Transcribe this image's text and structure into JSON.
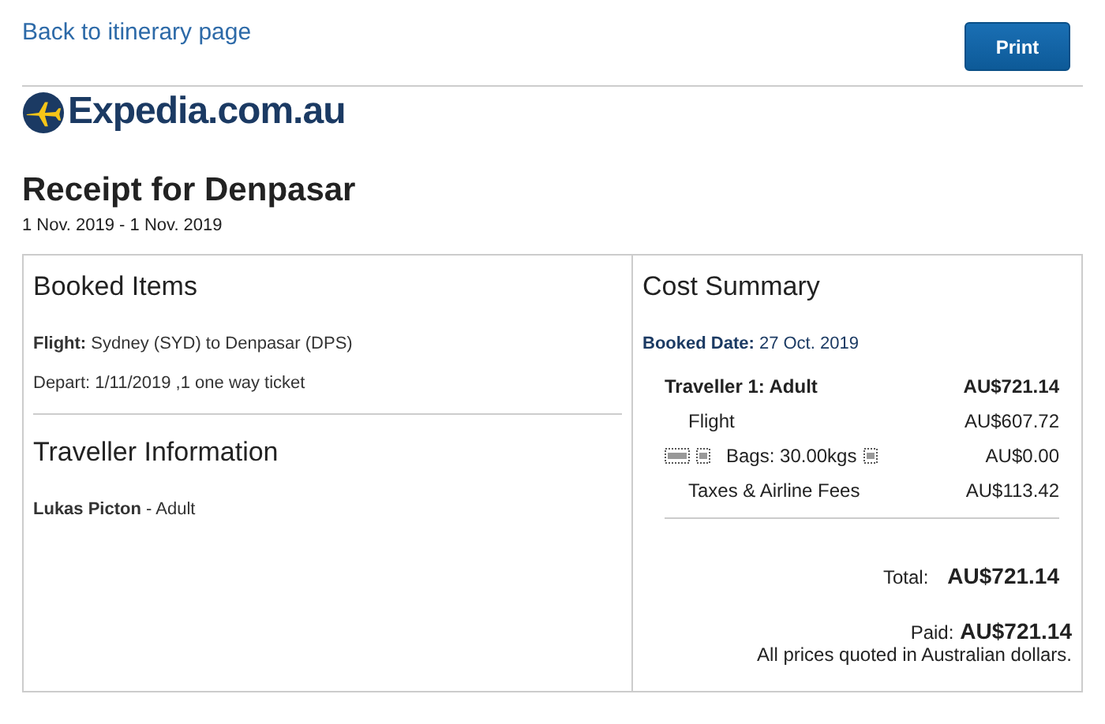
{
  "back_link": "Back to itinerary page",
  "print_button": "Print",
  "logo": "Expedia.com.au",
  "title": "Receipt for Denpasar",
  "dates": "1 Nov. 2019 - 1 Nov. 2019",
  "booked_items": {
    "heading": "Booked Items",
    "flight": "**Flight:** Sydney (SYD) to Denpasar (DPS)",
    "depart": "Depart: 1/11/2019 ,1 one way ticket"
  },
  "traveller_information": {
    "heading": "Traveller Information",
    "traveller": "**Lukas Picton** - Adult"
  },
  "cost_summary": {
    "heading": "Cost Summary",
    "booked_date": "**Booked Date:** 27 Oct. 2019",
    "rows": [
      {
        "kind": "traveller",
        "label": "Traveller 1: Adult",
        "amount": "AU$721.14"
      },
      {
        "kind": "item",
        "label": "Flight",
        "amount": "AU$607.72"
      },
      {
        "kind": "bags",
        "label": "Bags: 30.00kgs",
        "amount": "AU$0.00"
      },
      {
        "kind": "item",
        "label": "Taxes & Airline Fees",
        "amount": "AU$113.42"
      }
    ],
    "total_label": "Total:",
    "total": "AU$721.14",
    "paid_label": "Paid:",
    "paid": "AU$721.14",
    "note": "All prices quoted in Australian dollars."
  }
}
